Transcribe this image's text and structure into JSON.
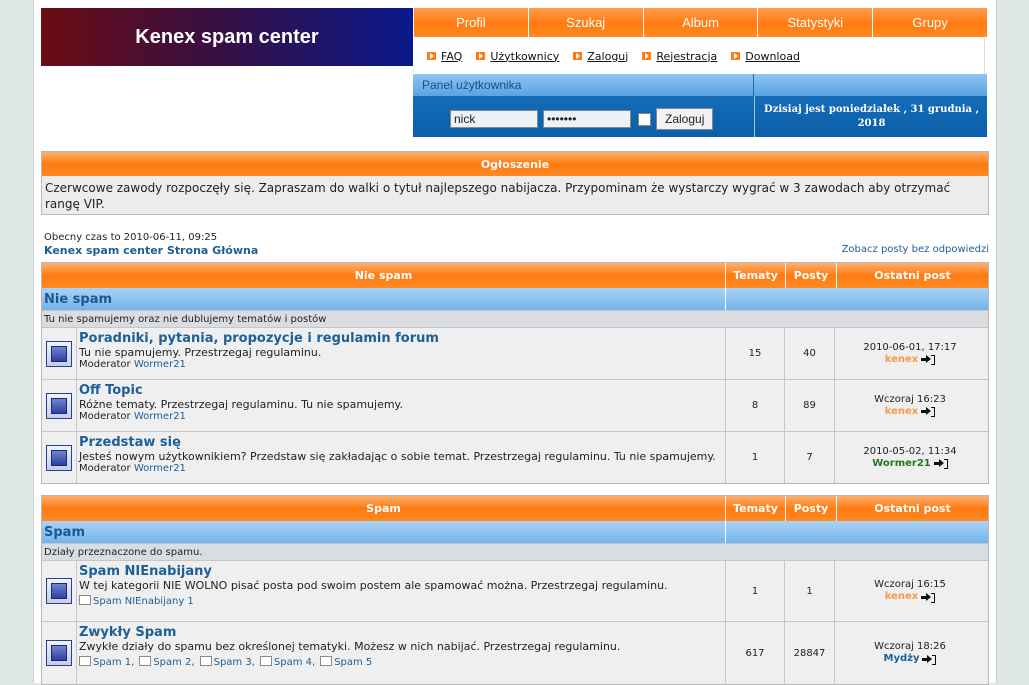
{
  "header": {
    "logo": "Kenex spam center",
    "nav": [
      "Profil",
      "Szukaj",
      "Album",
      "Statystyki",
      "Grupy"
    ],
    "sublinks": [
      "FAQ",
      "Użytkownicy",
      "Zaloguj",
      "Rejestracja",
      "Download"
    ]
  },
  "panel": {
    "title": "Panel użytkownika",
    "username": "nick",
    "password": "•••••••",
    "login_button": "Zaloguj",
    "date_line1": "Dzisiaj jest poniedziałek , 31 grudnia ,",
    "date_line2": "2018"
  },
  "announcement": {
    "heading": "Ogłoszenie",
    "text": "Czerwcowe zawody rozpoczęły się. Zapraszam do walki o tytuł najlepszego nabijacza. Przypominam że wystarczy wygrać w 3 zawodach aby otrzymać rangę VIP."
  },
  "info": {
    "current_time": "Obecny czas to 2010-06-11, 09:25",
    "index_title": "Kenex spam center Strona Główna",
    "unanswered": "Zobacz posty bez odpowiedzi"
  },
  "columns": {
    "topics": "Tematy",
    "posts": "Posty",
    "last_post": "Ostatni post"
  },
  "sections": [
    {
      "heading": "Nie spam",
      "category": "Nie spam",
      "category_desc": "Tu nie spamujemy oraz nie dublujemy tematów i postów",
      "forums": [
        {
          "title": "Poradniki, pytania, propozycje i regulamin forum",
          "desc": "Tu nie spamujemy. Przestrzegaj regulaminu.",
          "mod_label": "Moderator",
          "moderator": "Wormer21",
          "topics": "15",
          "posts": "40",
          "last_date": "2010-06-01, 17:17",
          "last_user": "kenex",
          "user_color": "#f59a4a"
        },
        {
          "title": "Off Topic",
          "desc": "Różne tematy. Przestrzegaj regulaminu. Tu nie spamujemy.",
          "mod_label": "Moderator",
          "moderator": "Wormer21",
          "topics": "8",
          "posts": "89",
          "last_date": "Wczoraj 16:23",
          "last_user": "kenex",
          "user_color": "#f59a4a"
        },
        {
          "title": "Przedstaw się",
          "desc": "Jesteś nowym użytkownikiem? Przedstaw się zakładając o sobie temat. Przestrzegaj regulaminu. Tu nie spamujemy.",
          "mod_label": "Moderator",
          "moderator": "Wormer21",
          "topics": "1",
          "posts": "7",
          "last_date": "2010-05-02, 11:34",
          "last_user": "Wormer21",
          "user_color": "#1e7a1e"
        }
      ]
    },
    {
      "heading": "Spam",
      "category": "Spam",
      "category_desc": "Działy przeznaczone do spamu.",
      "forums": [
        {
          "title": "Spam NIEnabijany",
          "desc": "W tej kategorii NIE WOLNO pisać posta pod swoim postem ale spamować można. Przestrzegaj regulaminu.",
          "subforums": [
            "Spam NIEnabijany 1"
          ],
          "topics": "1",
          "posts": "1",
          "last_date": "Wczoraj 16:15",
          "last_user": "kenex",
          "user_color": "#f59a4a"
        },
        {
          "title": "Zwykły Spam",
          "desc": "Zwykłe działy do spamu bez określonej tematyki. Możesz w nich nabijać. Przestrzegaj regulaminu.",
          "subforums": [
            "Spam 1,",
            "Spam 2,",
            "Spam 3,",
            "Spam 4,",
            "Spam 5"
          ],
          "topics": "617",
          "posts": "28847",
          "last_date": "Wczoraj 18:26",
          "last_user": "Mydży",
          "user_color": "#1d5f96"
        }
      ]
    }
  ]
}
